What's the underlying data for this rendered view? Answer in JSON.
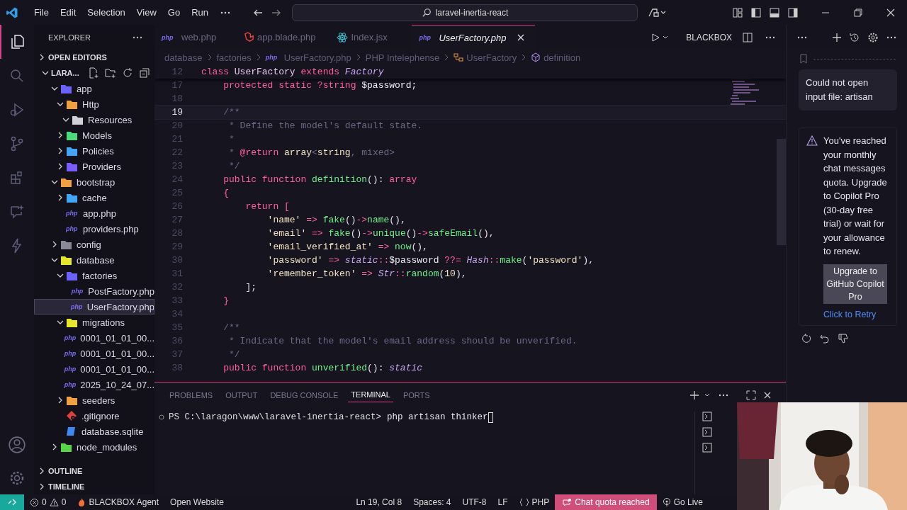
{
  "title_bar": {
    "menu": [
      "File",
      "Edit",
      "Selection",
      "View",
      "Go",
      "Run"
    ],
    "search": "laravel-inertia-react"
  },
  "activity_bar": {
    "items": [
      {
        "kind": "explorer",
        "selected": true
      },
      {
        "kind": "search",
        "selected": false
      },
      {
        "kind": "debug",
        "selected": false
      },
      {
        "kind": "source-control",
        "selected": false
      },
      {
        "kind": "extensions",
        "selected": false
      },
      {
        "kind": "chat",
        "selected": false
      },
      {
        "kind": "bolt",
        "selected": false
      }
    ]
  },
  "sidebar": {
    "title": "EXPLORER",
    "open_editors": "OPEN EDITORS",
    "tree": [
      {
        "label": "LARA...",
        "kind": "root",
        "expanded": true,
        "selected": false,
        "children": [
          {
            "label": "app",
            "kind": "folder",
            "color": "#6c63ff",
            "expanded": true,
            "selected": false,
            "children": [
              {
                "label": "Http",
                "kind": "folder",
                "color": "#f0a040",
                "expanded": true,
                "selected": false,
                "children": [
                  {
                    "label": "Resources",
                    "kind": "folder",
                    "color": "#d0d0d8",
                    "expanded": true,
                    "selected": false
                  }
                ]
              },
              {
                "label": "Models",
                "kind": "folder",
                "color": "#4cd97b",
                "expanded": false,
                "selected": false
              },
              {
                "label": "Policies",
                "kind": "folder",
                "color": "#42a5f5",
                "expanded": false,
                "selected": false
              },
              {
                "label": "Providers",
                "kind": "folder",
                "color": "#7c5cff",
                "expanded": false,
                "selected": false
              }
            ]
          },
          {
            "label": "bootstrap",
            "kind": "folder",
            "color": "#f0a040",
            "expanded": true,
            "selected": false,
            "children": [
              {
                "label": "cache",
                "kind": "folder",
                "color": "#42a5f5",
                "expanded": false,
                "selected": false
              },
              {
                "label": "app.php",
                "kind": "php",
                "icon_text": "php",
                "selected": false
              },
              {
                "label": "providers.php",
                "kind": "php",
                "icon_text": "php",
                "selected": false
              }
            ]
          },
          {
            "label": "config",
            "kind": "folder",
            "color": "#8a8a96",
            "expanded": false,
            "selected": false
          },
          {
            "label": "database",
            "kind": "folder",
            "color": "#e6e62a",
            "expanded": true,
            "selected": false,
            "children": [
              {
                "label": "factories",
                "kind": "folder",
                "color": "#6c63ff",
                "expanded": true,
                "selected": false,
                "children": [
                  {
                    "label": "PostFactory.php",
                    "kind": "php",
                    "icon_text": "php",
                    "selected": false
                  },
                  {
                    "label": "UserFactory.php",
                    "kind": "php",
                    "icon_text": "php",
                    "selected": true
                  }
                ]
              },
              {
                "label": "migrations",
                "kind": "folder",
                "color": "#e6e62a",
                "expanded": true,
                "selected": false,
                "children": [
                  {
                    "label": "0001_01_01_00...",
                    "kind": "php",
                    "icon_text": "php",
                    "selected": false
                  },
                  {
                    "label": "0001_01_01_00...",
                    "kind": "php",
                    "icon_text": "php",
                    "selected": false
                  },
                  {
                    "label": "0001_01_01_00...",
                    "kind": "php",
                    "icon_text": "php",
                    "selected": false
                  },
                  {
                    "label": "2025_10_24_07...",
                    "kind": "php",
                    "icon_text": "php",
                    "selected": false
                  }
                ]
              },
              {
                "label": "seeders",
                "kind": "folder",
                "color": "#f0a040",
                "expanded": false,
                "selected": false
              },
              {
                "label": ".gitignore",
                "kind": "git",
                "selected": false
              },
              {
                "label": "database.sqlite",
                "kind": "sqlite",
                "selected": false
              }
            ]
          },
          {
            "label": "node_modules",
            "kind": "folder",
            "color": "#5ad44a",
            "expanded": false,
            "selected": false
          }
        ]
      }
    ],
    "sections": [
      "OUTLINE",
      "TIMELINE"
    ]
  },
  "editor": {
    "tabs": [
      {
        "label": "web.php",
        "kind": "php",
        "icon_text": "php",
        "selected": false
      },
      {
        "label": "app.blade.php",
        "kind": "laravel",
        "selected": false
      },
      {
        "label": "Index.jsx",
        "kind": "react",
        "selected": false
      },
      {
        "label": "UserFactory.php",
        "kind": "php",
        "icon_text": "php",
        "selected": true
      }
    ],
    "actions_label": "BLACKBOX",
    "breadcrumb": [
      {
        "label": "database",
        "kind": "plain"
      },
      {
        "label": "factories",
        "kind": "plain"
      },
      {
        "label": "UserFactory.php",
        "kind": "php",
        "icon_text": "php"
      },
      {
        "label": "PHP Intelephense",
        "kind": "plain"
      },
      {
        "label": "UserFactory",
        "kind": "class"
      },
      {
        "label": "definition",
        "kind": "method"
      }
    ],
    "sticky_line": {
      "number": "12",
      "tokens": [
        {
          "kind": "kw",
          "text": "class "
        },
        {
          "kind": "ident",
          "text": "UserFactory "
        },
        {
          "kind": "kw",
          "text": "extends "
        },
        {
          "kind": "type",
          "text": "Factory"
        }
      ]
    },
    "lines": [
      {
        "number": "17",
        "current": false,
        "tokens": [
          {
            "kind": "kw",
            "text": "    protected static ?string "
          },
          {
            "kind": "var",
            "text": "$password;"
          }
        ]
      },
      {
        "number": "18",
        "current": false
      },
      {
        "number": "19",
        "current": true,
        "tokens": [
          {
            "kind": "cmt",
            "text": "    /**"
          }
        ]
      },
      {
        "number": "20",
        "current": false,
        "tokens": [
          {
            "kind": "cmt",
            "text": "     * Define the model's default state."
          }
        ]
      },
      {
        "number": "21",
        "current": false,
        "tokens": [
          {
            "kind": "cmt",
            "text": "     *"
          }
        ]
      },
      {
        "number": "22",
        "current": false,
        "tokens": [
          {
            "kind": "cmt",
            "text": "     * "
          },
          {
            "kind": "kw",
            "text": "@return "
          },
          {
            "kind": "str",
            "text": "array"
          },
          {
            "kind": "cmt",
            "text": "<"
          },
          {
            "kind": "str",
            "text": "string"
          },
          {
            "kind": "cmt",
            "text": ", mixed>"
          }
        ]
      },
      {
        "number": "23",
        "current": false,
        "tokens": [
          {
            "kind": "cmt",
            "text": "     */"
          }
        ]
      },
      {
        "number": "24",
        "current": false,
        "tokens": [
          {
            "kind": "kw",
            "text": "    public function "
          },
          {
            "kind": "fn",
            "text": "definition"
          },
          {
            "kind": "punc",
            "text": "(): "
          },
          {
            "kind": "kw",
            "text": "array"
          }
        ]
      },
      {
        "number": "25",
        "current": false,
        "tokens": [
          {
            "kind": "kw",
            "text": "    {"
          }
        ]
      },
      {
        "number": "26",
        "current": false,
        "tokens": [
          {
            "kind": "kw",
            "text": "        return "
          },
          {
            "kind": "op",
            "text": "["
          }
        ]
      },
      {
        "number": "27",
        "current": false,
        "tokens": [
          {
            "kind": "str",
            "text": "            'name'"
          },
          {
            "kind": "op",
            "text": " => "
          },
          {
            "kind": "fn",
            "text": "fake"
          },
          {
            "kind": "punc",
            "text": "()"
          },
          {
            "kind": "op",
            "text": "->"
          },
          {
            "kind": "fn",
            "text": "name"
          },
          {
            "kind": "punc",
            "text": "(),"
          }
        ]
      },
      {
        "number": "28",
        "current": false,
        "tokens": [
          {
            "kind": "str",
            "text": "            'email'"
          },
          {
            "kind": "op",
            "text": " => "
          },
          {
            "kind": "fn",
            "text": "fake"
          },
          {
            "kind": "punc",
            "text": "()"
          },
          {
            "kind": "op",
            "text": "->"
          },
          {
            "kind": "fn",
            "text": "unique"
          },
          {
            "kind": "punc",
            "text": "()"
          },
          {
            "kind": "op",
            "text": "->"
          },
          {
            "kind": "fn",
            "text": "safeEmail"
          },
          {
            "kind": "punc",
            "text": "(),"
          }
        ]
      },
      {
        "number": "29",
        "current": false,
        "tokens": [
          {
            "kind": "str",
            "text": "            'email_verified_at'"
          },
          {
            "kind": "op",
            "text": " => "
          },
          {
            "kind": "fn",
            "text": "now"
          },
          {
            "kind": "punc",
            "text": "(),"
          }
        ]
      },
      {
        "number": "30",
        "current": false,
        "tokens": [
          {
            "kind": "str",
            "text": "            'password'"
          },
          {
            "kind": "op",
            "text": " => "
          },
          {
            "kind": "type",
            "text": "static"
          },
          {
            "kind": "op",
            "text": "::"
          },
          {
            "kind": "var",
            "text": "$password "
          },
          {
            "kind": "op",
            "text": "??= "
          },
          {
            "kind": "type",
            "text": "Hash"
          },
          {
            "kind": "op",
            "text": "::"
          },
          {
            "kind": "fn",
            "text": "make"
          },
          {
            "kind": "punc",
            "text": "("
          },
          {
            "kind": "str",
            "text": "'password'"
          },
          {
            "kind": "punc",
            "text": "),"
          }
        ]
      },
      {
        "number": "31",
        "current": false,
        "tokens": [
          {
            "kind": "str",
            "text": "            'remember_token'"
          },
          {
            "kind": "op",
            "text": " => "
          },
          {
            "kind": "type",
            "text": "Str"
          },
          {
            "kind": "op",
            "text": "::"
          },
          {
            "kind": "fn",
            "text": "random"
          },
          {
            "kind": "punc",
            "text": "("
          },
          {
            "kind": "str",
            "text": "10"
          },
          {
            "kind": "punc",
            "text": "),"
          }
        ]
      },
      {
        "number": "32",
        "current": false,
        "tokens": [
          {
            "kind": "punc",
            "text": "        ];"
          }
        ]
      },
      {
        "number": "33",
        "current": false,
        "tokens": [
          {
            "kind": "kw",
            "text": "    }"
          }
        ]
      },
      {
        "number": "34",
        "current": false
      },
      {
        "number": "35",
        "current": false,
        "tokens": [
          {
            "kind": "cmt",
            "text": "    /**"
          }
        ]
      },
      {
        "number": "36",
        "current": false,
        "tokens": [
          {
            "kind": "cmt",
            "text": "     * Indicate that the model's email address should be unverified."
          }
        ]
      },
      {
        "number": "37",
        "current": false,
        "tokens": [
          {
            "kind": "cmt",
            "text": "     */"
          }
        ]
      },
      {
        "number": "38",
        "current": false,
        "tokens": [
          {
            "kind": "kw",
            "text": "    public function "
          },
          {
            "kind": "fn",
            "text": "unverified"
          },
          {
            "kind": "punc",
            "text": "(): "
          },
          {
            "kind": "type",
            "text": "static"
          }
        ]
      }
    ]
  },
  "panel": {
    "tabs": [
      {
        "label": "PROBLEMS",
        "selected": false
      },
      {
        "label": "OUTPUT",
        "selected": false
      },
      {
        "label": "DEBUG CONSOLE",
        "selected": false
      },
      {
        "label": "TERMINAL",
        "selected": true
      },
      {
        "label": "PORTS",
        "selected": false
      }
    ],
    "prompt": "PS C:\\laragon\\www\\laravel-inertia-react>",
    "command": "php artisan thinker"
  },
  "chat": {
    "message": "Could not open input file: artisan",
    "warning": "You've reached your monthly chat messages quota. Upgrade to Copilot Pro (30-day free trial) or wait for your allowance to renew.",
    "button": "Upgrade to GitHub Copilot Pro",
    "link": "Click to Retry"
  },
  "status_bar": {
    "errors": "0",
    "warnings": "0",
    "left": [
      {
        "label": "BLACKBOX Agent",
        "kind": "agent"
      },
      {
        "label": "Open Website",
        "kind": "plain"
      }
    ],
    "right": [
      {
        "label": "Ln 19, Col 8",
        "kind": "plain"
      },
      {
        "label": "Spaces: 4",
        "kind": "plain"
      },
      {
        "label": "UTF-8",
        "kind": "plain"
      },
      {
        "label": "LF",
        "kind": "plain"
      },
      {
        "label": "PHP",
        "kind": "language"
      },
      {
        "label": "Chat quota reached",
        "kind": "alert"
      },
      {
        "label": "Go Live",
        "kind": "live"
      }
    ]
  }
}
